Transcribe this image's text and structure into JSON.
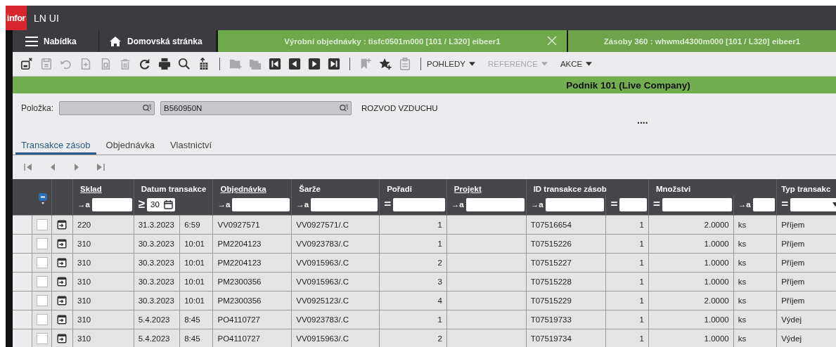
{
  "window": {
    "logo": "infor",
    "title": "LN UI"
  },
  "menu_button": {
    "label": "Nabídka"
  },
  "home_button": {
    "label": "Domovská stránka"
  },
  "session_tabs": [
    {
      "label": "Výrobní objednávky : tisfc0501m000 [101 / L320] eibeer1",
      "selected": true
    },
    {
      "label": "Zásoby 360 : whwmd4300m000 [101 / L320] eibeer1",
      "selected": false
    }
  ],
  "toolbar": {
    "buttons": [
      {
        "disabled": false
      },
      {
        "disabled": true
      },
      {
        "disabled": true
      },
      {
        "disabled": true
      },
      {
        "disabled": true
      },
      {
        "disabled": true
      },
      {
        "disabled": false
      },
      {
        "disabled": false
      },
      {
        "disabled": false
      },
      {
        "disabled": false
      },
      {
        "disabled": true
      },
      {
        "disabled": true
      },
      {
        "disabled": false
      },
      {
        "disabled": false
      },
      {
        "disabled": false
      },
      {
        "disabled": false
      },
      {
        "disabled": true
      },
      {
        "disabled": false
      },
      {
        "disabled": true
      }
    ],
    "menus": [
      {
        "label": "POHLEDY",
        "disabled": false
      },
      {
        "label": "REFERENCE",
        "disabled": true
      },
      {
        "label": "AKCE",
        "disabled": false
      }
    ]
  },
  "company": "Podnik 101 (Live Company)",
  "form": {
    "label": "Položka:",
    "value": "B560950N",
    "description": "ROZVOD VZDUCHU",
    "ellipsis": "...."
  },
  "detail_tabs": [
    {
      "label": "Transakce zásob",
      "selected": true
    },
    {
      "label": "Objednávka",
      "selected": false
    },
    {
      "label": "Vlastnictví",
      "selected": false
    }
  ],
  "table": {
    "columns": [
      {
        "label": "Sklad",
        "underlined": true,
        "filters": [
          {
            "kind": "text",
            "operator": "→a"
          }
        ]
      },
      {
        "label": "Datum transakce",
        "underlined": false,
        "filters": [
          {
            "kind": "date",
            "operator": "≥",
            "value": "30"
          }
        ]
      },
      {
        "label": "Objednávka",
        "underlined": true,
        "filters": [
          {
            "kind": "text",
            "operator": "→a"
          }
        ]
      },
      {
        "label": "Šarže",
        "underlined": false,
        "filters": [
          {
            "kind": "text",
            "operator": "→a"
          }
        ]
      },
      {
        "label": "Pořadi",
        "underlined": false,
        "filters": [
          {
            "kind": "text",
            "operator": "="
          }
        ]
      },
      {
        "label": "Projekt",
        "underlined": true,
        "filters": [
          {
            "kind": "text",
            "operator": "→a"
          }
        ]
      },
      {
        "label": "ID transakce zásob",
        "underlined": false,
        "filters": [
          {
            "kind": "text",
            "operator": "→a"
          },
          {
            "kind": "text",
            "operator": "="
          }
        ]
      },
      {
        "label": "Množstvi",
        "underlined": false,
        "filters": [
          {
            "kind": "text",
            "operator": "="
          },
          {
            "kind": "text",
            "operator": "→a"
          }
        ]
      },
      {
        "label": "Typ transakc",
        "underlined": false,
        "filters": [
          {
            "kind": "select",
            "operator": "="
          }
        ]
      }
    ],
    "rows": [
      {
        "checked": false,
        "sklad": "220",
        "datum": "31.3.2023",
        "cas": "6:59",
        "objednavka": "VV0927571",
        "sarze": "VV0927571/.C",
        "poradi": "1",
        "id": "T07516654",
        "id_seq": "1",
        "mnozstvi": "2.0000",
        "jednotka": "ks",
        "typ": "Příjem"
      },
      {
        "checked": false,
        "sklad": "310",
        "datum": "30.3.2023",
        "cas": "10:01",
        "objednavka": "PM2204123",
        "sarze": "VV0923783/.C",
        "poradi": "1",
        "id": "T07515226",
        "id_seq": "1",
        "mnozstvi": "1.0000",
        "jednotka": "ks",
        "typ": "Příjem"
      },
      {
        "checked": false,
        "sklad": "310",
        "datum": "30.3.2023",
        "cas": "10:01",
        "objednavka": "PM2204123",
        "sarze": "VV0915963/.C",
        "poradi": "2",
        "id": "T07515227",
        "id_seq": "1",
        "mnozstvi": "1.0000",
        "jednotka": "ks",
        "typ": "Příjem"
      },
      {
        "checked": false,
        "sklad": "310",
        "datum": "30.3.2023",
        "cas": "10:01",
        "objednavka": "PM2300356",
        "sarze": "VV0915963/.C",
        "poradi": "3",
        "id": "T07515228",
        "id_seq": "1",
        "mnozstvi": "1.0000",
        "jednotka": "ks",
        "typ": "Příjem"
      },
      {
        "checked": false,
        "sklad": "310",
        "datum": "30.3.2023",
        "cas": "10:01",
        "objednavka": "PM2300356",
        "sarze": "VV0925123/.C",
        "poradi": "4",
        "id": "T07515229",
        "id_seq": "1",
        "mnozstvi": "2.0000",
        "jednotka": "ks",
        "typ": "Příjem"
      },
      {
        "checked": false,
        "sklad": "310",
        "datum": "5.4.2023",
        "cas": "8:45",
        "objednavka": "PO4110727",
        "sarze": "VV0923783/.C",
        "poradi": "1",
        "id": "T07519733",
        "id_seq": "1",
        "mnozstvi": "1.0000",
        "jednotka": "ks",
        "typ": "Výdej"
      },
      {
        "checked": false,
        "sklad": "310",
        "datum": "5.4.2023",
        "cas": "8:45",
        "objednavka": "PO4110727",
        "sarze": "VV0915963/.C",
        "poradi": "2",
        "id": "T07519734",
        "id_seq": "1",
        "mnozstvi": "1.0000",
        "jednotka": "ks",
        "typ": "Výdej"
      }
    ]
  }
}
